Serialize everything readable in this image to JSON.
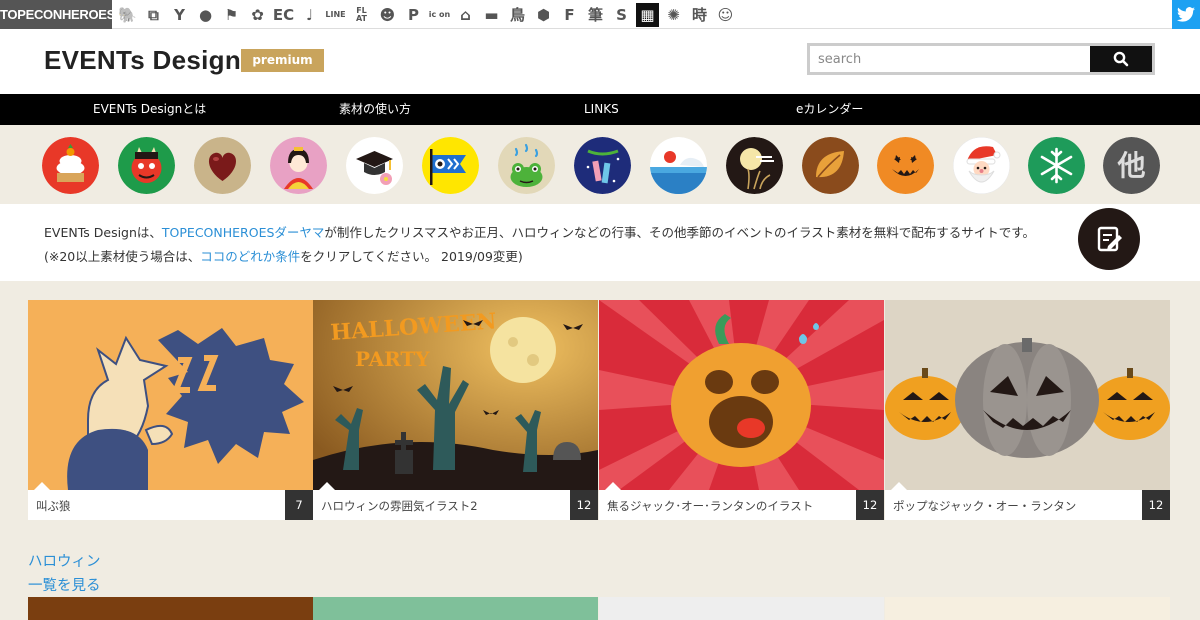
{
  "network": {
    "brand": "TOPECONHEROES",
    "icons": [
      {
        "name": "animal-icon",
        "glyph": "🐘"
      },
      {
        "name": "copy-icon",
        "glyph": "⧉"
      },
      {
        "name": "person-icon",
        "glyph": "Y"
      },
      {
        "name": "speech-bubble-icon",
        "glyph": "●"
      },
      {
        "name": "flag-icon",
        "glyph": "⚑"
      },
      {
        "name": "flower-icon",
        "glyph": "✿"
      },
      {
        "name": "ec-text-icon",
        "glyph": "EC"
      },
      {
        "name": "music-note-icon",
        "glyph": "♩"
      },
      {
        "name": "line-icon",
        "glyph": "LINE"
      },
      {
        "name": "flat-icon",
        "glyph": "FL AT"
      },
      {
        "name": "smiley-icon",
        "glyph": "☻"
      },
      {
        "name": "parking-icon",
        "glyph": "P"
      },
      {
        "name": "icon-text-icon",
        "glyph": "ic on"
      },
      {
        "name": "house-icon",
        "glyph": "⌂"
      },
      {
        "name": "sofa-icon",
        "glyph": "▬"
      },
      {
        "name": "bird-kanji-icon",
        "glyph": "鳥"
      },
      {
        "name": "gear-icon",
        "glyph": "⬢"
      },
      {
        "name": "f-letter-icon",
        "glyph": "F"
      },
      {
        "name": "brush-kanji-icon",
        "glyph": "筆"
      },
      {
        "name": "s-letter-icon",
        "glyph": "S"
      },
      {
        "name": "grid-icon",
        "glyph": "▦"
      },
      {
        "name": "burst-icon",
        "glyph": "✺"
      },
      {
        "name": "time-kanji-icon",
        "glyph": "時"
      },
      {
        "name": "face-icon",
        "glyph": "☺"
      }
    ]
  },
  "header": {
    "logo": "EVENTs Design",
    "badge": "premium",
    "search_placeholder": "search"
  },
  "nav": [
    "EVENTs Designとは",
    "素材の使い方",
    "LINKS",
    "eカレンダー"
  ],
  "categories": [
    {
      "name": "kagami-mochi",
      "color": "#e83828"
    },
    {
      "name": "oni",
      "color": "#1e9b4a"
    },
    {
      "name": "heart",
      "color": "#c9b48a"
    },
    {
      "name": "hina-doll",
      "color": "#e8a1c4"
    },
    {
      "name": "graduation",
      "color": "#ffffff"
    },
    {
      "name": "koinobori",
      "color": "#ffe600"
    },
    {
      "name": "frog",
      "color": "#e2d8b8"
    },
    {
      "name": "tanabata",
      "color": "#1e2c7a"
    },
    {
      "name": "summer",
      "color": "#ffffff"
    },
    {
      "name": "moon",
      "color": "#231815"
    },
    {
      "name": "leaf",
      "color": "#8a4b1c"
    },
    {
      "name": "pumpkin",
      "color": "#f08a24"
    },
    {
      "name": "santa",
      "color": "#ffffff"
    },
    {
      "name": "snowflake",
      "color": "#1e9b5a"
    },
    {
      "name": "other",
      "color": "#555555",
      "label": "他"
    }
  ],
  "intro": {
    "line1_a": "EVENTs Designは、",
    "line1_link": "TOPECONHEROESダーヤマ",
    "line1_b": "が制作したクリスマスやお正月、ハロウィンなどの行事、その他季節のイベントのイラスト素材を無料で配布するサイトです。",
    "line2_a": "(※20以上素材使う場合は、",
    "line2_link": "ココのどれか条件",
    "line2_b": "をクリアしてください。 2019/09変更)"
  },
  "cards": [
    {
      "title": "叫ぶ狼",
      "count": "7",
      "bg": "#f5b058"
    },
    {
      "title": "ハロウィンの雰囲気イラスト2",
      "count": "12",
      "bg": "#c78a3a"
    },
    {
      "title": "焦るジャック･オー･ランタンのイラスト",
      "count": "12",
      "bg": "#d92b3a"
    },
    {
      "title": "ポップなジャック・オー・ランタン",
      "count": "12",
      "bg": "#ddd5c5"
    }
  ],
  "section": {
    "title": "ハロウィン",
    "more": "一覧を見る"
  },
  "next_row_colors": [
    "#7a3e10",
    "#7fc09a",
    "#eeeeee",
    "#f6efe0"
  ]
}
